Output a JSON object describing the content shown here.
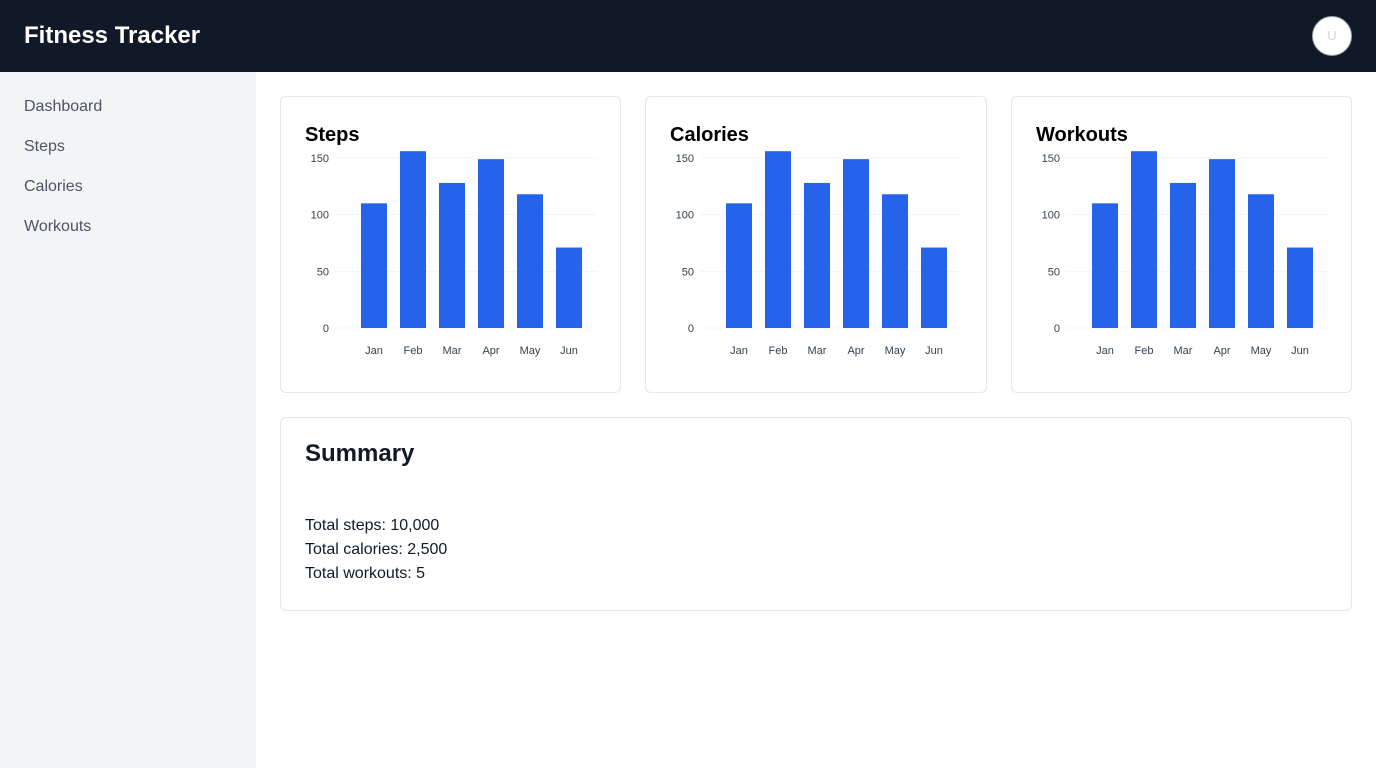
{
  "header": {
    "title": "Fitness Tracker",
    "avatar_initial": "U"
  },
  "sidebar": {
    "items": [
      {
        "label": "Dashboard"
      },
      {
        "label": "Steps"
      },
      {
        "label": "Calories"
      },
      {
        "label": "Workouts"
      }
    ]
  },
  "charts": {
    "steps": {
      "title": "Steps"
    },
    "calories": {
      "title": "Calories"
    },
    "workouts": {
      "title": "Workouts"
    }
  },
  "chart_data": [
    {
      "type": "bar",
      "title": "Steps",
      "categories": [
        "Jan",
        "Feb",
        "Mar",
        "Apr",
        "May",
        "Jun"
      ],
      "values": [
        110,
        156,
        128,
        149,
        118,
        71
      ],
      "yticks": [
        0,
        50,
        100,
        150
      ],
      "ylim": [
        0,
        150
      ],
      "grid": true,
      "color": "#2563eb"
    },
    {
      "type": "bar",
      "title": "Calories",
      "categories": [
        "Jan",
        "Feb",
        "Mar",
        "Apr",
        "May",
        "Jun"
      ],
      "values": [
        110,
        156,
        128,
        149,
        118,
        71
      ],
      "yticks": [
        0,
        50,
        100,
        150
      ],
      "ylim": [
        0,
        150
      ],
      "grid": true,
      "color": "#2563eb"
    },
    {
      "type": "bar",
      "title": "Workouts",
      "categories": [
        "Jan",
        "Feb",
        "Mar",
        "Apr",
        "May",
        "Jun"
      ],
      "values": [
        110,
        156,
        128,
        149,
        118,
        71
      ],
      "yticks": [
        0,
        50,
        100,
        150
      ],
      "ylim": [
        0,
        150
      ],
      "grid": true,
      "color": "#2563eb"
    }
  ],
  "summary": {
    "title": "Summary",
    "lines": [
      "Total steps: 10,000",
      "Total calories: 2,500",
      "Total workouts: 5"
    ]
  }
}
